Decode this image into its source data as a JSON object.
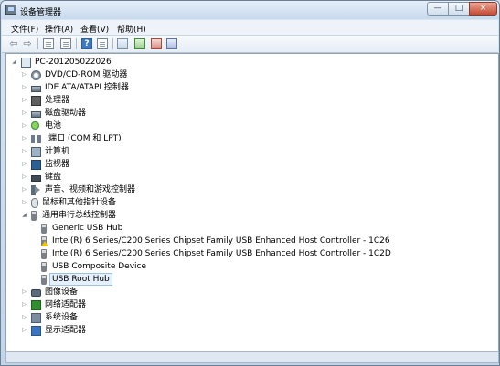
{
  "window": {
    "title": "设备管理器",
    "minimize": "—",
    "maximize": "□",
    "close": "×"
  },
  "menu": [
    "文件(F)",
    "操作(A)",
    "查看(V)",
    "帮助(H)"
  ],
  "toolbar": {
    "buttons": [
      {
        "name": "back-icon",
        "label": "⇦"
      },
      {
        "name": "forward-icon",
        "label": "⇨"
      },
      {
        "name": "properties-sheet-icon"
      },
      {
        "name": "list-view-icon"
      },
      {
        "name": "help-icon",
        "label": "?"
      },
      {
        "name": "details-view-icon"
      },
      {
        "name": "scan-hardware-icon"
      },
      {
        "name": "update-driver-icon"
      },
      {
        "name": "disable-device-icon"
      },
      {
        "name": "uninstall-device-icon"
      }
    ]
  },
  "tree": {
    "root": "PC-201205022026",
    "items": [
      {
        "label": "DVD/CD-ROM 驱动器",
        "icon": "disk-icon"
      },
      {
        "label": "IDE ATA/ATAPI 控制器",
        "icon": "drive-icon"
      },
      {
        "label": "处理器",
        "icon": "chip-icon"
      },
      {
        "label": "磁盘驱动器",
        "icon": "drive-icon"
      },
      {
        "label": "电池",
        "icon": "battery-icon"
      },
      {
        "label": "端口 (COM 和 LPT)",
        "icon": "port-icon"
      },
      {
        "label": "计算机",
        "icon": "computer-icon"
      },
      {
        "label": "监视器",
        "icon": "monitor-icon"
      },
      {
        "label": "键盘",
        "icon": "keyboard-icon"
      },
      {
        "label": "声音、视频和游戏控制器",
        "icon": "speaker-icon"
      },
      {
        "label": "鼠标和其他指针设备",
        "icon": "mouse-icon"
      },
      {
        "label": "通用串行总线控制器",
        "icon": "usb-icon"
      },
      {
        "label": "Generic USB Hub",
        "icon": "usb-icon"
      },
      {
        "label": "Intel(R) 6 Series/C200 Series Chipset Family USB Enhanced Host Controller - 1C26",
        "icon": "usb-warning-icon"
      },
      {
        "label": "Intel(R) 6 Series/C200 Series Chipset Family USB Enhanced Host Controller - 1C2D",
        "icon": "usb-icon"
      },
      {
        "label": "USB Composite Device",
        "icon": "usb-icon"
      },
      {
        "label": "USB Root Hub",
        "icon": "usb-icon"
      },
      {
        "label": "图像设备",
        "icon": "camera-icon"
      },
      {
        "label": "网络适配器",
        "icon": "network-icon"
      },
      {
        "label": "系统设备",
        "icon": "system-icon"
      },
      {
        "label": "显示适配器",
        "icon": "display-icon"
      }
    ]
  },
  "status": {
    "text": ""
  }
}
